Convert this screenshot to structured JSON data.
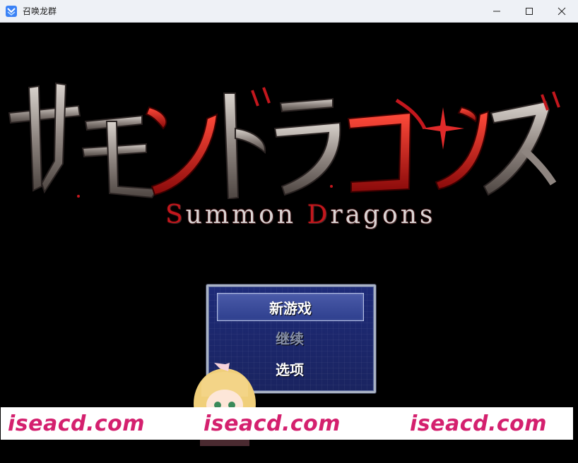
{
  "window": {
    "title": "召唤龙群",
    "controls": {
      "minimize": "minimize",
      "maximize": "maximize",
      "close": "close"
    }
  },
  "logo": {
    "japanese": "サモンドラゴンズ",
    "subtitle_first": "S",
    "subtitle_mid": "ummon ",
    "subtitle_second": "D",
    "subtitle_end": "ragons"
  },
  "menu": {
    "items": [
      {
        "label": "新游戏",
        "state": "selected"
      },
      {
        "label": "继续",
        "state": "disabled"
      },
      {
        "label": "选项",
        "state": "normal"
      }
    ]
  },
  "watermark": {
    "texts": [
      "iseacd.com",
      "iseacd.com",
      "iseacd.com"
    ]
  },
  "colors": {
    "titlebar_bg": "#eef1f6",
    "menu_bg": "#1d2a78",
    "logo_red": "#c3171d",
    "watermark": "#d4206e"
  }
}
